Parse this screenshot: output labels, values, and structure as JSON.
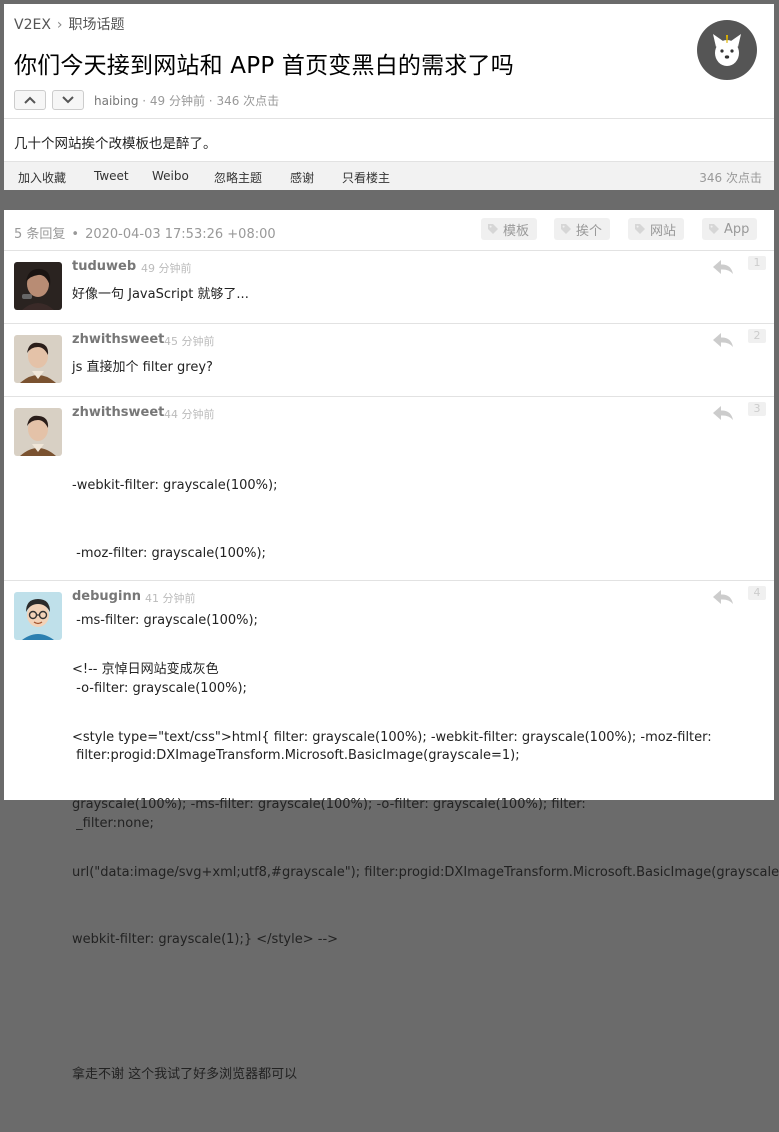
{
  "breadcrumb": {
    "site": "V2EX",
    "separator": "›",
    "node": "职场话题"
  },
  "topic": {
    "title": "你们今天接到网站和 APP 首页变黑白的需求了吗",
    "author": "haibing",
    "meta_rest": " · 49 分钟前 · 346 次点击",
    "body": "几十个网站挨个改模板也是醉了。",
    "actions": [
      "加入收藏",
      "Tweet",
      "Weibo",
      "忽略主题",
      "感谢",
      "只看楼主"
    ],
    "hits": "346 次点击"
  },
  "replies_header": {
    "count": "5 条回复",
    "dot": "•",
    "datetime": "2020-04-03 17:53:26 +08:00",
    "tags": [
      "模板",
      "挨个",
      "网站",
      "App"
    ]
  },
  "replies": [
    {
      "user": "tuduweb",
      "ago": "49 分钟前",
      "floor": "1",
      "lines": [
        "好像一句 JavaScript 就够了..."
      ]
    },
    {
      "user": "zhwithsweet",
      "ago": "45 分钟前",
      "floor": "2",
      "lines": [
        "js 直接加个 filter grey?"
      ]
    },
    {
      "user": "zhwithsweet",
      "ago": "44 分钟前",
      "floor": "3",
      "lines": [
        "-webkit-filter: grayscale(100%);",
        " -moz-filter: grayscale(100%);",
        " -ms-filter: grayscale(100%);",
        " -o-filter: grayscale(100%);",
        " filter:progid:DXImageTransform.Microsoft.BasicImage(grayscale=1);",
        " _filter:none;"
      ]
    },
    {
      "user": "debuginn",
      "ago": "41 分钟前",
      "floor": "4",
      "lines": [
        "<!-- 京悼日网站变成灰色",
        "<style type=\"text/css\">html{ filter: grayscale(100%); -webkit-filter: grayscale(100%); -moz-filter:",
        "grayscale(100%); -ms-filter: grayscale(100%); -o-filter: grayscale(100%); filter:",
        "url(\"data:image/svg+xml;utf8,#grayscale\"); filter:progid:DXImageTransform.Microsoft.BasicImage(grayscale=1); -",
        "webkit-filter: grayscale(1);} </style> -->",
        "",
        "拿走不谢 这个我试了好多浏览器都可以"
      ]
    }
  ]
}
